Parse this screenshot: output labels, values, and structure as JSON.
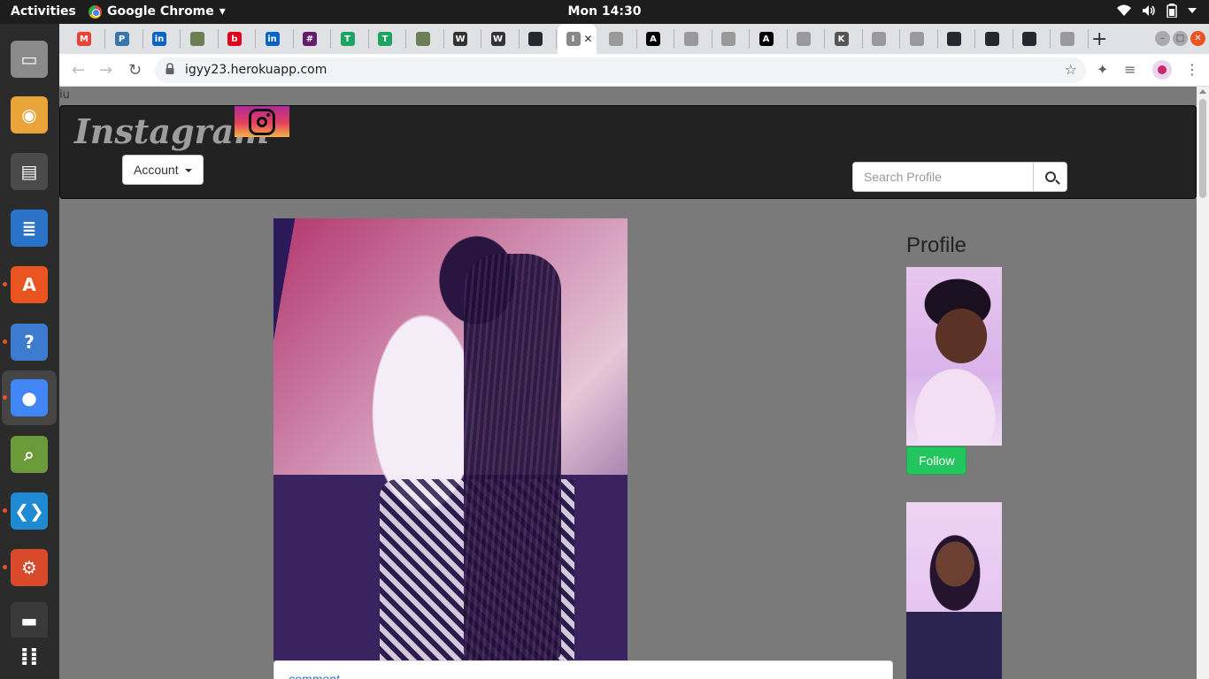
{
  "topbar": {
    "activities": "Activities",
    "app_name": "Google Chrome",
    "app_menu_arrow": "▾",
    "clock": "Mon 14:30"
  },
  "dock": {
    "items": [
      {
        "name": "files-icon",
        "color": "#8a8a8a"
      },
      {
        "name": "rhythmbox-icon",
        "color": "#e9a43a"
      },
      {
        "name": "video-editor-icon",
        "color": "#4a4a4a"
      },
      {
        "name": "writer-icon",
        "color": "#2a73c9"
      },
      {
        "name": "software-center-icon",
        "color": "#e95420"
      },
      {
        "name": "help-icon",
        "color": "#3d7bd1"
      },
      {
        "name": "chrome-icon",
        "color": "#4285f4"
      },
      {
        "name": "image-viewer-icon",
        "color": "#6a9a3a"
      },
      {
        "name": "vscode-icon",
        "color": "#1f8ad2"
      },
      {
        "name": "settings-icon",
        "color": "#d94a2a"
      },
      {
        "name": "scanner-icon",
        "color": "#3a3a3a"
      },
      {
        "name": "app-grid-icon",
        "color": "#2b2b2b"
      }
    ]
  },
  "browser": {
    "tabs": [
      {
        "letter": "M",
        "color": "#ea4335"
      },
      {
        "letter": "P",
        "color": "#3776ab"
      },
      {
        "letter": "in",
        "color": "#0a66c2"
      },
      {
        "letter": "",
        "color": "#6b7f55"
      },
      {
        "letter": "b",
        "color": "#e0001b"
      },
      {
        "letter": "in",
        "color": "#0a66c2"
      },
      {
        "letter": "#",
        "color": "#611f69"
      },
      {
        "letter": "T",
        "color": "#1da462"
      },
      {
        "letter": "T",
        "color": "#1da462"
      },
      {
        "letter": "",
        "color": "#6b7f55"
      },
      {
        "letter": "W",
        "color": "#333333"
      },
      {
        "letter": "W",
        "color": "#333333"
      },
      {
        "letter": "",
        "color": "#24292f"
      },
      {
        "letter": "I",
        "color": "#888888"
      },
      {
        "letter": "",
        "color": "#999999"
      },
      {
        "letter": "A",
        "color": "#000000"
      },
      {
        "letter": "",
        "color": "#999999"
      },
      {
        "letter": "",
        "color": "#999999"
      },
      {
        "letter": "A",
        "color": "#000000"
      },
      {
        "letter": "",
        "color": "#999999"
      },
      {
        "letter": "K",
        "color": "#555555"
      },
      {
        "letter": "",
        "color": "#999999"
      },
      {
        "letter": "",
        "color": "#999999"
      },
      {
        "letter": "",
        "color": "#24292f"
      },
      {
        "letter": "",
        "color": "#24292f"
      },
      {
        "letter": "",
        "color": "#24292f"
      },
      {
        "letter": "",
        "color": "#999999"
      }
    ],
    "active_tab_index": 13,
    "active_tab_close": "✕",
    "new_tab": "+",
    "url": "igyy23.herokuapp.com"
  },
  "page": {
    "stray_text": "iu",
    "brand": "Instagram",
    "account_label": "Account",
    "search_placeholder": "Search Profile",
    "comment_label": "comment",
    "profile_heading": "Profile",
    "follow_label": "Follow",
    "accent_green": "#22c55e"
  }
}
